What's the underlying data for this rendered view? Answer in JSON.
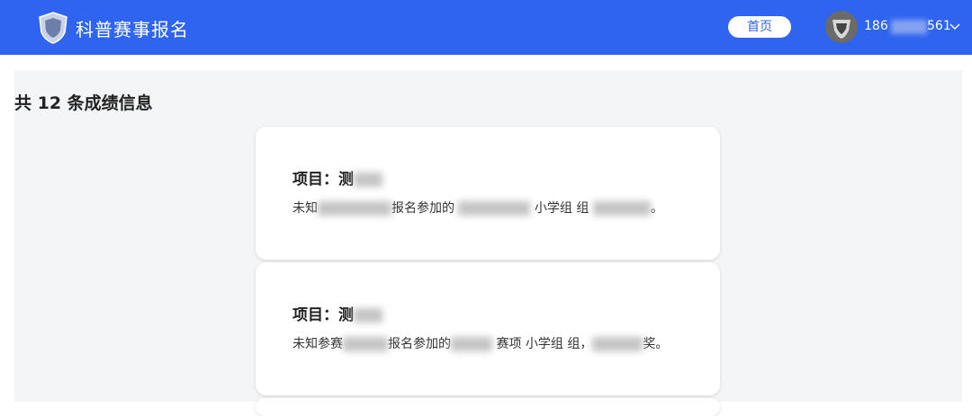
{
  "header": {
    "app_title": "科普赛事报名",
    "home_label": "首页",
    "user_prefix": "186",
    "user_suffix": "561"
  },
  "main": {
    "count_title": "共 12 条成绩信息"
  },
  "cards": [
    {
      "project_label": "项目：",
      "project_value": "测",
      "desc_prefix": "未知",
      "desc_mid1": "报名参加的",
      "desc_mid2": "小学组 组",
      "desc_end": "。"
    },
    {
      "project_label": "项目：",
      "project_value": "测",
      "desc_prefix": "未知参赛",
      "desc_mid1": "报名参加的",
      "desc_mid2": "赛项 小学组 组，",
      "desc_end": "奖。"
    }
  ]
}
